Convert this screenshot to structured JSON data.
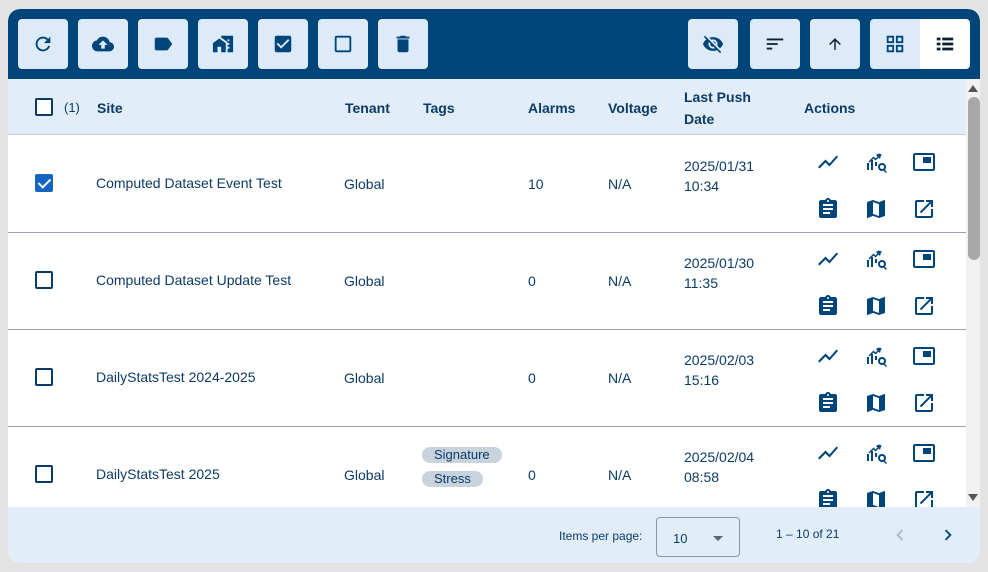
{
  "toolbar": {
    "left_buttons": [
      {
        "name": "refresh",
        "icon": "refresh-icon"
      },
      {
        "name": "upload",
        "icon": "cloud-upload-icon"
      },
      {
        "name": "label",
        "icon": "label-icon"
      },
      {
        "name": "home-work",
        "icon": "home-work-icon"
      },
      {
        "name": "check-all",
        "icon": "checkbox-checked-icon"
      },
      {
        "name": "uncheck-all",
        "icon": "checkbox-empty-icon"
      },
      {
        "name": "delete",
        "icon": "trash-icon"
      }
    ],
    "right_buttons": [
      {
        "name": "hide",
        "icon": "eye-off-icon"
      },
      {
        "name": "sort",
        "icon": "sort-icon"
      },
      {
        "name": "sort-direction",
        "icon": "arrow-up-icon"
      }
    ],
    "view_toggle": {
      "grid_icon": "grid-view-icon",
      "list_icon": "list-view-icon",
      "selected": "list"
    }
  },
  "table": {
    "selected_count": "(1)",
    "headers": {
      "site": "Site",
      "tenant": "Tenant",
      "tags": "Tags",
      "alarms": "Alarms",
      "voltage": "Voltage",
      "last_push_line1": "Last Push",
      "last_push_line2": "Date",
      "actions": "Actions"
    },
    "rows": [
      {
        "checked": true,
        "site": "Computed Dataset Event Test",
        "tenant": "Global",
        "tags": [],
        "alarms": "10",
        "voltage": "N/A",
        "date": "2025/01/31",
        "time": "10:34"
      },
      {
        "checked": false,
        "site": "Computed Dataset Update Test",
        "tenant": "Global",
        "tags": [],
        "alarms": "0",
        "voltage": "N/A",
        "date": "2025/01/30",
        "time": "11:35"
      },
      {
        "checked": false,
        "site": "DailyStatsTest 2024-2025",
        "tenant": "Global",
        "tags": [],
        "alarms": "0",
        "voltage": "N/A",
        "date": "2025/02/03",
        "time": "15:16"
      },
      {
        "checked": false,
        "site": "DailyStatsTest 2025",
        "tenant": "Global",
        "tags": [
          "Signature",
          "Stress"
        ],
        "alarms": "0",
        "voltage": "N/A",
        "date": "2025/02/04",
        "time": "08:58"
      }
    ],
    "action_icons": [
      "trend-line-icon",
      "analytics-search-icon",
      "picture-in-picture-icon",
      "clipboard-icon",
      "map-icon",
      "open-external-icon"
    ]
  },
  "footer": {
    "items_per_page_label": "Items per page:",
    "items_per_page_value": "10",
    "range_label": "1 – 10 of 21",
    "prev_icon": "chevron-left-icon",
    "next_icon": "chevron-right-icon"
  },
  "colors": {
    "toolbar_bg": "#00457a",
    "button_bg": "#dcebf7",
    "header_bg": "#e1edf8",
    "text": "#0b3b66",
    "checkbox_checked": "#1565c0"
  }
}
